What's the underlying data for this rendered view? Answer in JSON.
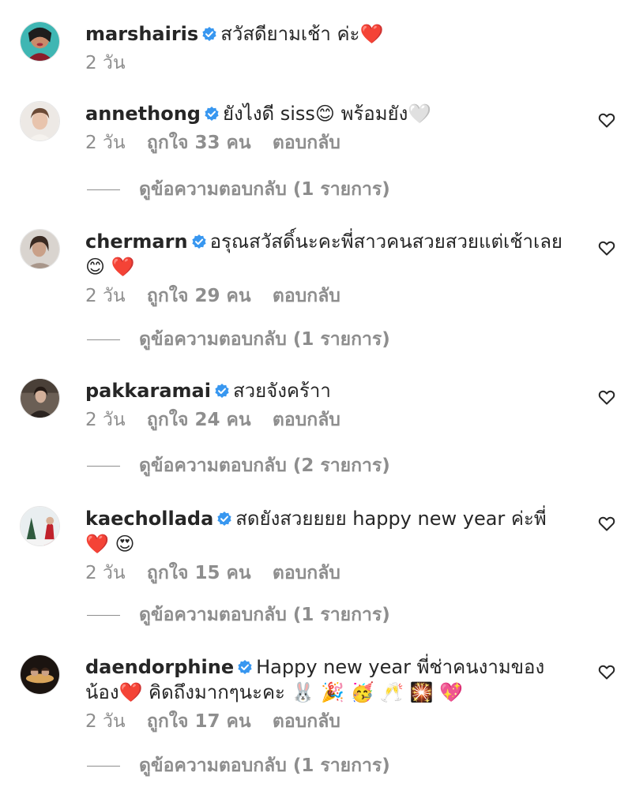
{
  "comments": [
    {
      "username": "marshairis",
      "text": "สวัสดียามเช้า ค่ะ❤️",
      "time": "2 วัน",
      "likes": "",
      "reply": "",
      "view_replies": ""
    },
    {
      "username": "annethong",
      "text": "ยังไงดี siss😊 พร้อมยัง🤍",
      "time": "2 วัน",
      "likes": "ถูกใจ 33 คน",
      "reply": "ตอบกลับ",
      "view_replies": "ดูข้อความตอบกลับ (1 รายการ)"
    },
    {
      "username": "chermarn",
      "text": "อรุณสวัสดิ์นะคะพี่สาวคนสวยสวยแต่เช้าเลย😊 ❤️",
      "time": "2 วัน",
      "likes": "ถูกใจ 29 คน",
      "reply": "ตอบกลับ",
      "view_replies": "ดูข้อความตอบกลับ (1 รายการ)"
    },
    {
      "username": "pakkaramai",
      "text": "สวยจังคร้าา",
      "time": "2 วัน",
      "likes": "ถูกใจ 24 คน",
      "reply": "ตอบกลับ",
      "view_replies": "ดูข้อความตอบกลับ (2 รายการ)"
    },
    {
      "username": "kaechollada",
      "text": "สดยังสวยยยย happy new year ค่ะพี่ ❤️ 😍",
      "time": "2 วัน",
      "likes": "ถูกใจ 15 คน",
      "reply": "ตอบกลับ",
      "view_replies": "ดูข้อความตอบกลับ (1 รายการ)"
    },
    {
      "username": "daendorphine",
      "text": "Happy new year พี่ช่าคนงามของน้อง❤️ คิดถึงมากๆนะคะ 🐰 🎉 🥳 🥂 🎇 💖",
      "time": "2 วัน",
      "likes": "ถูกใจ 17 คน",
      "reply": "ตอบกลับ",
      "view_replies": "ดูข้อความตอบกลับ (1 รายการ)"
    }
  ],
  "colors": {
    "verified": "#3897f0",
    "muted": "#8e8e8e",
    "text": "#262626"
  },
  "icons": {
    "verified": "verified-badge-icon",
    "like": "heart-outline-icon"
  }
}
